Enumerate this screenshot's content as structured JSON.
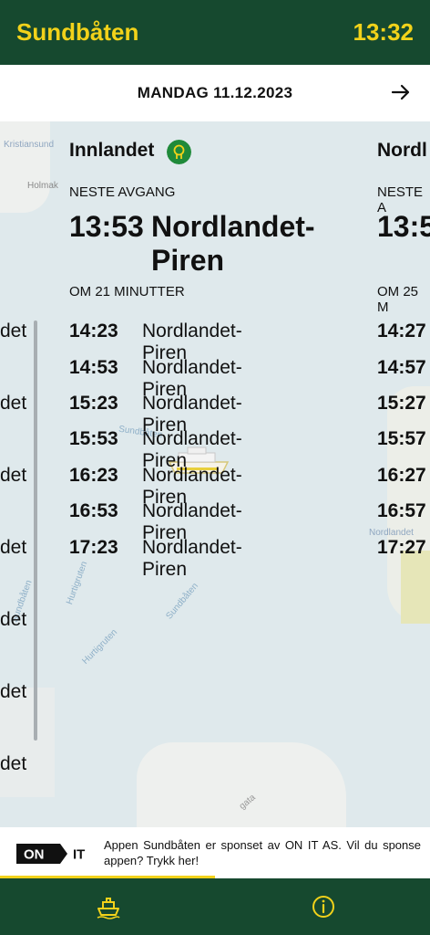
{
  "header": {
    "title": "Sundbåten",
    "time": "13:32"
  },
  "datebar": {
    "date": "MANDAG 11.12.2023",
    "next_icon": "arrow-right-icon"
  },
  "map_labels": {
    "kristiansund": "Kristiansund",
    "holmak": "Holmak",
    "sundbaten": "Sundbåten",
    "hurtigruten": "Hurtigruten",
    "nordlandet": "Nordlandet",
    "gata": "gata"
  },
  "stop": {
    "name": "Innlandet",
    "neste_label": "NESTE AVGANG",
    "next_time": "13:53",
    "next_dest": "Nordlandet-Piren",
    "om_label": "OM 21 MINUTTER",
    "departures": [
      {
        "time": "14:23",
        "dest": "Nordlandet-Piren"
      },
      {
        "time": "14:53",
        "dest": "Nordlandet-Piren"
      },
      {
        "time": "15:23",
        "dest": "Nordlandet-Piren"
      },
      {
        "time": "15:53",
        "dest": "Nordlandet-Piren"
      },
      {
        "time": "16:23",
        "dest": "Nordlandet-Piren"
      },
      {
        "time": "16:53",
        "dest": "Nordlandet-Piren"
      },
      {
        "time": "17:23",
        "dest": "Nordlandet-Piren"
      }
    ]
  },
  "right_panel": {
    "name": "Nordl",
    "neste_label": "NESTE A",
    "next_time": "13:5",
    "om_label": "OM 25 M",
    "times": [
      "14:27",
      "14:57",
      "15:27",
      "15:57",
      "16:27",
      "16:57",
      "17:27"
    ]
  },
  "left_panel": {
    "fragments": [
      "det",
      "det",
      "det",
      "det",
      "det",
      "det",
      "det"
    ]
  },
  "sponsor": {
    "logo_on": "ON",
    "logo_it": "IT",
    "text": "Appen Sundbåten er sponset av ON IT AS. Vil du sponse appen? Trykk her!"
  },
  "tabs": [
    {
      "icon": "ferry-icon"
    },
    {
      "icon": "info-icon"
    }
  ],
  "colors": {
    "brand_green": "#16492f",
    "accent_yellow": "#f2d21a",
    "stop_icon_green": "#1f8a3a"
  }
}
